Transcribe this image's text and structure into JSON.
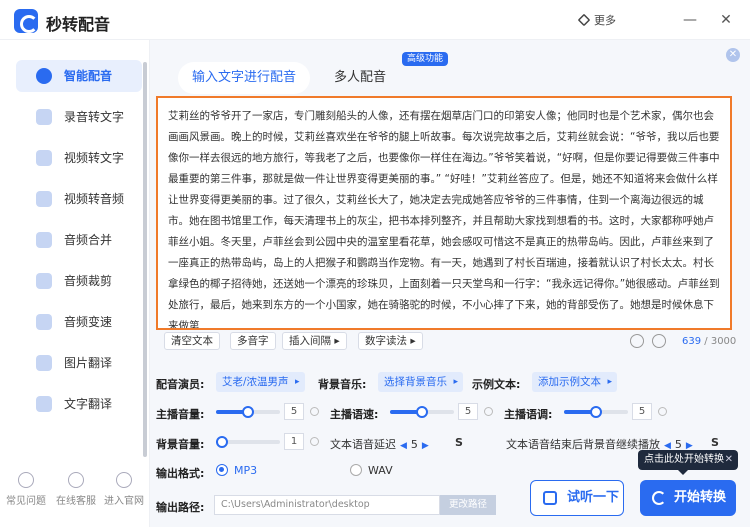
{
  "app": {
    "title": "秒转配音",
    "more": "更多",
    "minimize": "—",
    "close": "✕"
  },
  "sidebar": {
    "items": [
      {
        "label": "智能配音",
        "icon": "mic-icon",
        "active": true
      },
      {
        "label": "录音转文字",
        "icon": "record-to-text-icon"
      },
      {
        "label": "视频转文字",
        "icon": "video-to-text-icon"
      },
      {
        "label": "视频转音频",
        "icon": "video-to-audio-icon"
      },
      {
        "label": "音频合并",
        "icon": "audio-merge-icon"
      },
      {
        "label": "音频裁剪",
        "icon": "audio-cut-icon"
      },
      {
        "label": "音频变速",
        "icon": "audio-speed-icon"
      },
      {
        "label": "图片翻译",
        "icon": "image-translate-icon"
      },
      {
        "label": "文字翻译",
        "icon": "text-translate-icon"
      }
    ],
    "bottom": [
      {
        "label": "常见问题",
        "icon": "help-icon"
      },
      {
        "label": "在线客服",
        "icon": "service-icon"
      },
      {
        "label": "进入官网",
        "icon": "website-icon"
      }
    ]
  },
  "tabs": {
    "input_text": "输入文字进行配音",
    "multi": "多人配音",
    "badge": "高级功能"
  },
  "text": {
    "content": "艾莉丝的爷爷开了一家店，专门雕刻船头的人像，还有摆在烟草店门口的印第安人像；他同时也是个艺术家，偶尔也会画画风景画。晚上的时候，艾莉丝喜欢坐在爷爷的腿上听故事。每次说完故事之后，艾莉丝就会说：“爷爷，我以后也要像你一样去很远的地方旅行，等我老了之后，也要像你一样住在海边。”爷爷笑着说，“好啊，但是你要记得要做三件事中最重要的第三件事，那就是做一件让世界变得更美丽的事。” “好哇！”艾莉丝答应了。但是，她还不知道将来会做什么样让世界变得更美丽的事。过了很久，艾莉丝长大了，她决定去完成她答应爷爷的三件事情，住到一个离海边很远的城市。她在图书馆里工作，每天清理书上的灰尘，把书本排列整齐，并且帮助大家找到想看的书。这时，大家都称呼她卢菲丝小姐。冬天里，卢菲丝会到公园中央的温室里看花草，她会感叹可惜这不是真正的热带岛屿。因此，卢菲丝来到了一座真正的热带岛屿，岛上的人把猴子和鹦鹉当作宠物。有一天，她遇到了村长百瑞迪，接着就认识了村长太太。村长拿绿色的椰子招待她，还送她一个漂亮的珍珠贝，上面刻着一只天堂鸟和一行字：“我永远记得你。”她很感动。卢菲丝到处旅行，最后，她来到东方的一个小国家，她在骑骆驼的时候，不小心摔了下来，她的背部受伤了。她想是时候休息下来做第",
    "count": "639",
    "max": "/ 3000"
  },
  "toolbar": {
    "clear": "清空文本",
    "polyphone": "多音字",
    "pause": "插入间隔 ▸",
    "digits": "数字读法 ▸"
  },
  "settings": {
    "voice_label": "配音演员:",
    "voice_value": "艾老/浓温男声",
    "bgm_label": "背景音乐:",
    "bgm_value": "选择背景音乐",
    "sample_label": "示例文本:",
    "sample_value": "添加示例文本",
    "volume_label": "主播音量:",
    "volume_value": "5",
    "volume_level": 0.5,
    "speed_label": "主播语速:",
    "speed_value": "5",
    "speed_level": 0.5,
    "pitch_label": "主播语调:",
    "pitch_value": "5",
    "pitch_level": 0.5,
    "bg_volume_label": "背景音量:",
    "bg_volume_value": "1",
    "bg_volume_level": 0.1,
    "delay_label": "文本语音延迟",
    "delay_value": "5",
    "delay_unit": "S",
    "end_label": "文本语音结束后背景音继续播放",
    "end_value": "5",
    "end_unit": "S",
    "format_label": "输出格式:",
    "format_mp3": "MP3",
    "format_wav": "WAV",
    "path_label": "输出路径:",
    "path_value": "C:\\Users\\Administrator\\desktop",
    "path_button": "更改路径"
  },
  "actions": {
    "listen": "试听一下",
    "convert": "开始转换",
    "tooltip": "点击此处开始转换",
    "tooltip_close": "✕"
  },
  "colors": {
    "accent": "#2a6bf0",
    "highlight_border": "#f07a2a"
  }
}
